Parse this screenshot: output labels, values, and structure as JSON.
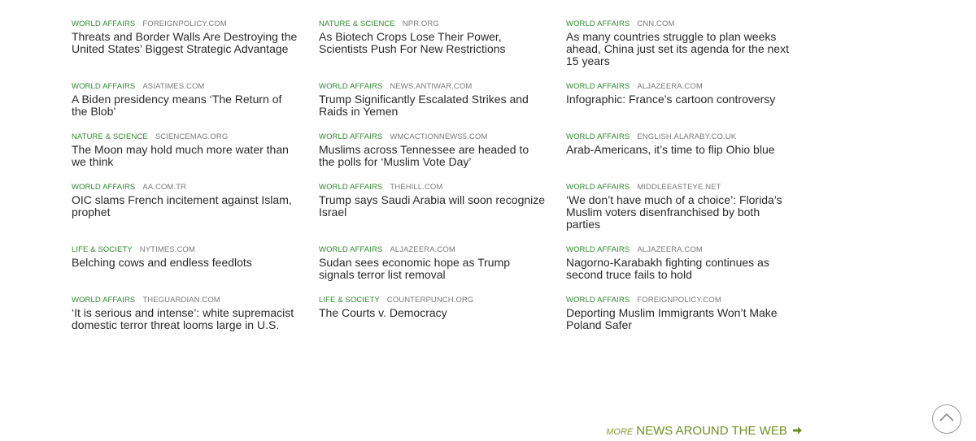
{
  "rows": [
    [
      {
        "category": "WORLD AFFAIRS",
        "source": "FOREIGNPOLICY.COM",
        "title": "Threats and Border Walls Are Destroying the United States’ Biggest Strategic Advantage"
      },
      {
        "category": "NATURE & SCIENCE",
        "source": "NPR.ORG",
        "title": "As Biotech Crops Lose Their Power, Scientists Push For New Restrictions"
      },
      {
        "category": "WORLD AFFAIRS",
        "source": "CNN.COM",
        "title": "As many countries struggle to plan weeks ahead, China just set its agenda for the next 15 years"
      }
    ],
    [
      {
        "category": "WORLD AFFAIRS",
        "source": "ASIATIMES.COM",
        "title": "A Biden presidency means ‘The Return of the Blob’"
      },
      {
        "category": "WORLD AFFAIRS",
        "source": "NEWS.ANTIWAR.COM",
        "title": "Trump Significantly Escalated Strikes and Raids in Yemen"
      },
      {
        "category": "WORLD AFFAIRS",
        "source": "ALJAZEERA.COM",
        "title": "Infographic: France’s cartoon controversy"
      }
    ],
    [
      {
        "category": "NATURE & SCIENCE",
        "source": "SCIENCEMAG.ORG",
        "title": "The Moon may hold much more water than we think"
      },
      {
        "category": "WORLD AFFAIRS",
        "source": "WMCACTIONNEWS5.COM",
        "title": "Muslims across Tennessee are headed to the polls for ‘Muslim Vote Day’"
      },
      {
        "category": "WORLD AFFAIRS",
        "source": "ENGLISH.ALARABY.CO.UK",
        "title": "Arab-Americans, it’s time to flip Ohio blue"
      }
    ],
    [
      {
        "category": "WORLD AFFAIRS",
        "source": "AA.COM.TR",
        "title": "OIC slams French incitement against Islam, prophet"
      },
      {
        "category": "WORLD AFFAIRS",
        "source": "THEHILL.COM",
        "title": "Trump says Saudi Arabia will soon recognize Israel"
      },
      {
        "category": "WORLD AFFAIRS",
        "source": "MIDDLEEASTEYE.NET",
        "title": "‘We don’t have much of a choice’: Florida’s Muslim voters disenfranchised by both parties"
      }
    ],
    [
      {
        "category": "LIFE & SOCIETY",
        "source": "NYTIMES.COM",
        "title": "Belching cows and endless feedlots"
      },
      {
        "category": "WORLD AFFAIRS",
        "source": "ALJAZEERA.COM",
        "title": "Sudan sees economic hope as Trump signals terror list removal"
      },
      {
        "category": "WORLD AFFAIRS",
        "source": "ALJAZEERA.COM",
        "title": "Nagorno-Karabakh fighting continues as second truce fails to hold"
      }
    ],
    [
      {
        "category": "WORLD AFFAIRS",
        "source": "THEGUARDIAN.COM",
        "title": "‘It is serious and intense’: white supremacist domestic terror threat looms large in U.S."
      },
      {
        "category": "LIFE & SOCIETY",
        "source": "COUNTERPUNCH.ORG",
        "title": "The Courts v. Democracy"
      },
      {
        "category": "WORLD AFFAIRS",
        "source": "FOREIGNPOLICY.COM",
        "title": "Deporting Muslim Immigrants Won’t Make Poland Safer"
      }
    ]
  ],
  "more_link": {
    "prefix": "MORE",
    "label": "NEWS AROUND THE WEB"
  },
  "icons": {
    "more_arrow": "arrow-right-icon",
    "scroll_top": "chevron-up-icon"
  },
  "colors": {
    "category": "#2e8a2e",
    "source": "#7a7a7a",
    "title": "#2a2a2a",
    "more": "#6f8f1f"
  }
}
